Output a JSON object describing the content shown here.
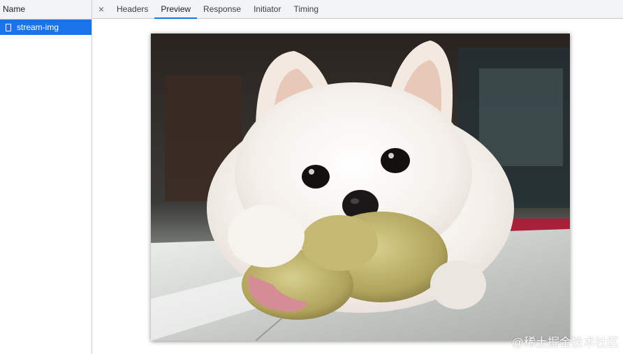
{
  "network": {
    "name_column_header": "Name",
    "requests": [
      {
        "label": "stream-img",
        "selected": true
      }
    ]
  },
  "detail": {
    "close_symbol": "×",
    "tabs": [
      {
        "label": "Headers",
        "active": false
      },
      {
        "label": "Preview",
        "active": true
      },
      {
        "label": "Response",
        "active": false
      },
      {
        "label": "Initiator",
        "active": false
      },
      {
        "label": "Timing",
        "active": false
      }
    ]
  },
  "preview": {
    "image_subject": "white puppy chewing a plush toy"
  },
  "watermark": {
    "text": "@稀土掘金技术社区"
  },
  "colors": {
    "selection": "#1a73e8",
    "toolbar_bg": "#f1f3f4",
    "divider": "#cbcdd1"
  },
  "icons": {
    "request_icon": "file-icon",
    "close_icon": "close-icon"
  }
}
